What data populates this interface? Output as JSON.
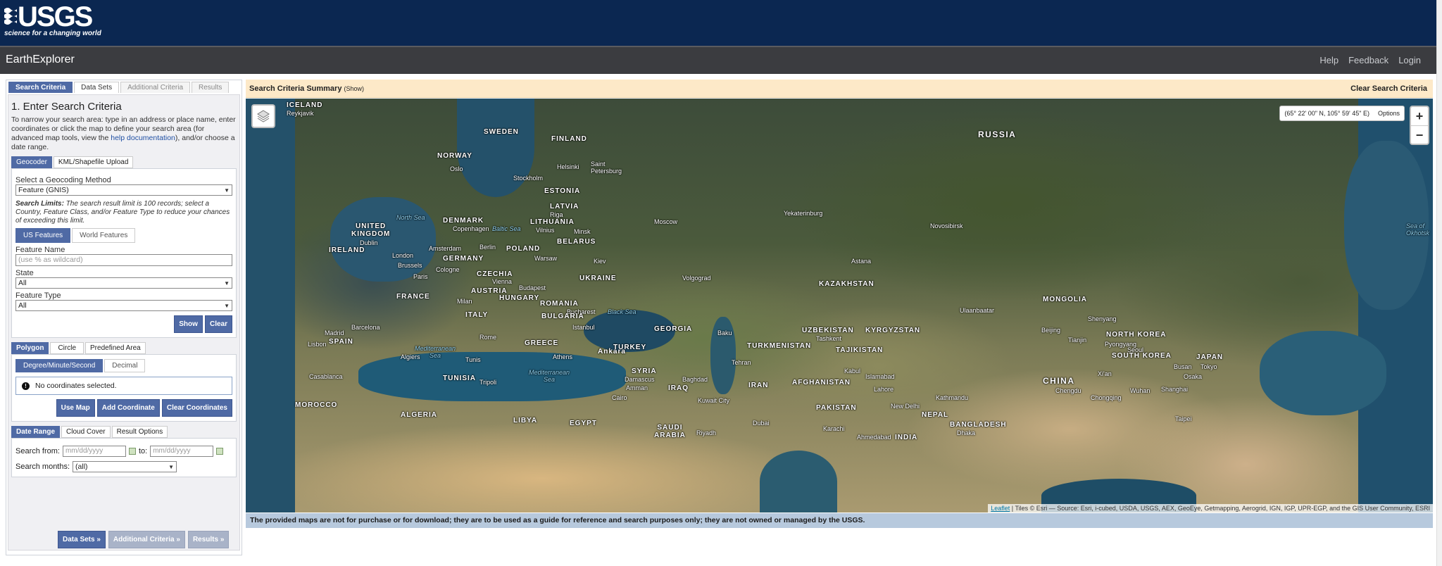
{
  "header": {
    "logo_text": "USGS",
    "logo_tagline": "science for a changing world"
  },
  "navbar": {
    "app_title": "EarthExplorer",
    "help": "Help",
    "feedback": "Feedback",
    "login": "Login"
  },
  "main_tabs": {
    "search_criteria": "Search Criteria",
    "data_sets": "Data Sets",
    "additional_criteria": "Additional Criteria",
    "results": "Results"
  },
  "step": {
    "title": "1. Enter Search Criteria",
    "intro_before": "To narrow your search area: type in an address or place name, enter coordinates or click the map to define your search area (for advanced map tools, view the ",
    "intro_link": "help documentation",
    "intro_after": "), and/or choose a date range."
  },
  "geo_tabs": {
    "geocoder": "Geocoder",
    "kml": "KML/Shapefile Upload"
  },
  "geocoder": {
    "method_label": "Select a Geocoding Method",
    "method_value": "Feature (GNIS)",
    "limits_bold": "Search Limits:",
    "limits_text": " The search result limit is 100 records; select a Country, Feature Class, and/or Feature Type to reduce your chances of exceeding this limit.",
    "us_features": "US Features",
    "world_features": "World Features",
    "feature_name_label": "Feature Name",
    "feature_name_placeholder": "(use % as wildcard)",
    "state_label": "State",
    "state_value": "All",
    "feature_type_label": "Feature Type",
    "feature_type_value": "All",
    "show": "Show",
    "clear": "Clear"
  },
  "area_tabs": {
    "polygon": "Polygon",
    "circle": "Circle",
    "predefined": "Predefined Area"
  },
  "coord_tabs": {
    "dms": "Degree/Minute/Second",
    "decimal": "Decimal"
  },
  "coords_box": {
    "message": "No coordinates selected.",
    "use_map": "Use Map",
    "add_coordinate": "Add Coordinate",
    "clear_coordinates": "Clear Coordinates"
  },
  "date_tabs": {
    "date_range": "Date Range",
    "cloud_cover": "Cloud Cover",
    "result_options": "Result Options"
  },
  "date_range": {
    "from_label": "Search from:",
    "from_placeholder": "mm/dd/yyyy",
    "to_label": "to:",
    "to_placeholder": "mm/dd/yyyy",
    "months_label": "Search months:",
    "months_value": "(all)"
  },
  "footer_buttons": {
    "data_sets": "Data Sets »",
    "additional_criteria": "Additional Criteria »",
    "results": "Results »"
  },
  "criteria_bar": {
    "title": "Search Criteria Summary",
    "show": "(Show)",
    "clear": "Clear Search Criteria"
  },
  "map": {
    "coordinate_readout": "(65° 22' 00\" N, 105° 59' 45\" E)",
    "options": "Options",
    "zoom_in": "+",
    "zoom_out": "−",
    "attribution_link": "Leaflet",
    "attribution_text": " | Tiles © Esri — Source: Esri, i-cubed, USDA, USGS, AEX, GeoEye, Getmapping, Aerogrid, IGN, IGP, UPR-EGP, and the GIS User Community, ESRI",
    "labels": {
      "russia": "RUSSIA",
      "sweden": "SWEDEN",
      "finland": "FINLAND",
      "norway": "NORWAY",
      "estonia": "ESTONIA",
      "latvia": "LATVIA",
      "lithuania": "LITHUANIA",
      "denmark": "DENMARK",
      "united_kingdom": "UNITED\nKINGDOM",
      "ireland": "IRELAND",
      "germany": "GERMANY",
      "poland": "POLAND",
      "belarus": "BELARUS",
      "czechia": "CZECHIA",
      "austria": "AUSTRIA",
      "hungary": "HUNGARY",
      "ukraine": "UKRAINE",
      "france": "FRANCE",
      "romania": "ROMANIA",
      "bulgaria": "BULGARIA",
      "italy": "ITALY",
      "spain": "SPAIN",
      "greece": "GREECE",
      "turkey": "TURKEY",
      "georgia": "GEORGIA",
      "kazakhstan": "KAZAKHSTAN",
      "mongolia": "MONGOLIA",
      "uzbekistan": "UZBEKISTAN",
      "kyrgyzstan": "KYRGYZSTAN",
      "turkmenistan": "TURKMENISTAN",
      "tajikistan": "TAJIKISTAN",
      "afghanistan": "AFGHANISTAN",
      "iran": "IRAN",
      "iraq": "IRAQ",
      "syria": "SYRIA",
      "china": "CHINA",
      "north_korea": "NORTH KOREA",
      "south_korea": "SOUTH KOREA",
      "japan": "JAPAN",
      "pakistan": "PAKISTAN",
      "nepal": "NEPAL",
      "india": "INDIA",
      "bangladesh": "BANGLADESH",
      "tunisia": "TUNISIA",
      "morocco": "MOROCCO",
      "algeria": "ALGERIA",
      "libya": "LIBYA",
      "egypt": "EGYPT",
      "saudi_arabia": "SAUDI\nARABIA",
      "north_sea": "North Sea",
      "baltic_sea": "Baltic Sea",
      "black_sea": "Black Sea",
      "mediterranean": "Mediterranean\nSea",
      "mediterranean2": "Mediterranean\nSea",
      "sea_of_okhotsk": "Sea of\nOkhotsk",
      "helsinki": "Helsinki",
      "stockholm": "Stockholm",
      "saint_petersburg": "Saint\nPetersburg",
      "oslo": "Oslo",
      "moscow": "Moscow",
      "riga": "Riga",
      "vilnius": "Vilnius",
      "minsk": "Minsk",
      "copenhagen": "Copenhagen",
      "amsterdam": "Amsterdam",
      "berlin": "Berlin",
      "dublin": "Dublin",
      "london": "London",
      "brussels": "Brussels",
      "cologne": "Cologne",
      "paris": "Paris",
      "warsaw": "Warsaw",
      "kyiv": "Kiev",
      "vienna": "Vienna",
      "budapest": "Budapest",
      "milan": "Milan",
      "bucharest": "Bucharest",
      "istanbul": "Istanbul",
      "ankara": "Ankara",
      "athens": "Athens",
      "rome": "Rome",
      "madrid": "Madrid",
      "lisbon": "Lisbon",
      "barcelona": "Barcelona",
      "algiers": "Algiers",
      "tunis": "Tunis",
      "casablanca": "Casablanca",
      "tripoli": "Tripoli",
      "cairo": "Cairo",
      "damascus": "Damascus",
      "amman": "Amman",
      "baghdad": "Baghdad",
      "tehran": "Tehran",
      "baku": "Baku",
      "kuwait_city": "Kuwait City",
      "dubai": "Dubai",
      "riyadh": "Riyadh",
      "volgograd": "Volgograd",
      "yekaterinburg": "Yekaterinburg",
      "novosibirsk": "Novosibirsk",
      "astana": "Astana",
      "tashkent": "Tashkent",
      "kabul": "Kabul",
      "islamabad": "Islamabad",
      "lahore": "Lahore",
      "karachi": "Karachi",
      "ahmedabad": "Ahmedabad",
      "new_delhi": "New Delhi",
      "kathmandu": "Kathmandu",
      "ulaanbaatar": "Ulaanbaatar",
      "shenyang": "Shenyang",
      "beijing": "Beijing",
      "tianjin": "Tianjin",
      "pyongyang": "Pyongyang",
      "seoul": "Seoul",
      "busan": "Busan",
      "osaka": "Osaka",
      "tokyo": "Tokyo",
      "xian": "Xi'an",
      "chengdu": "Chengdu",
      "chongqing": "Chongqing",
      "wuhan": "Wuhan",
      "shanghai": "Shanghai",
      "taipei": "Taipei",
      "dhaka": "Dhaka",
      "island": "ICELAND",
      "reykjavik": "Reykjavik"
    }
  },
  "disclaimer": "The provided maps are not for purchase or for download; they are to be used as a guide for reference and search purposes only; they are not owned or managed by the USGS."
}
